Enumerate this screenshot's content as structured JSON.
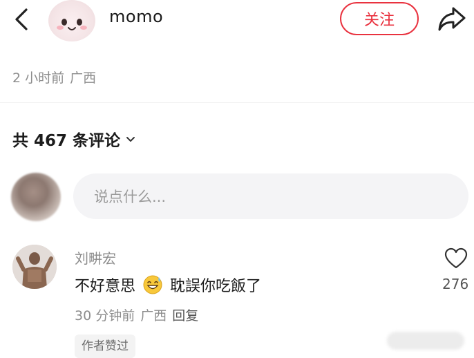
{
  "header": {
    "back_icon": "chevron-left-icon",
    "author_name": "momo",
    "follow_label": "关注",
    "share_icon": "share-arrow-icon",
    "accent_color": "#e9323f"
  },
  "post_meta": {
    "time": "2 小时前",
    "location": "广西"
  },
  "comments": {
    "count_label": "共 467 条评论",
    "input_placeholder": "说点什么...",
    "items": [
      {
        "author": "刘畊宏",
        "text_before": "不好意思",
        "emoji": "grinning-sweat-emoji",
        "text_after": "耽誤你吃飯了",
        "likes": "276",
        "time": "30 分钟前",
        "location": "广西",
        "reply_label": "回复",
        "badge": "作者赞过"
      }
    ]
  }
}
